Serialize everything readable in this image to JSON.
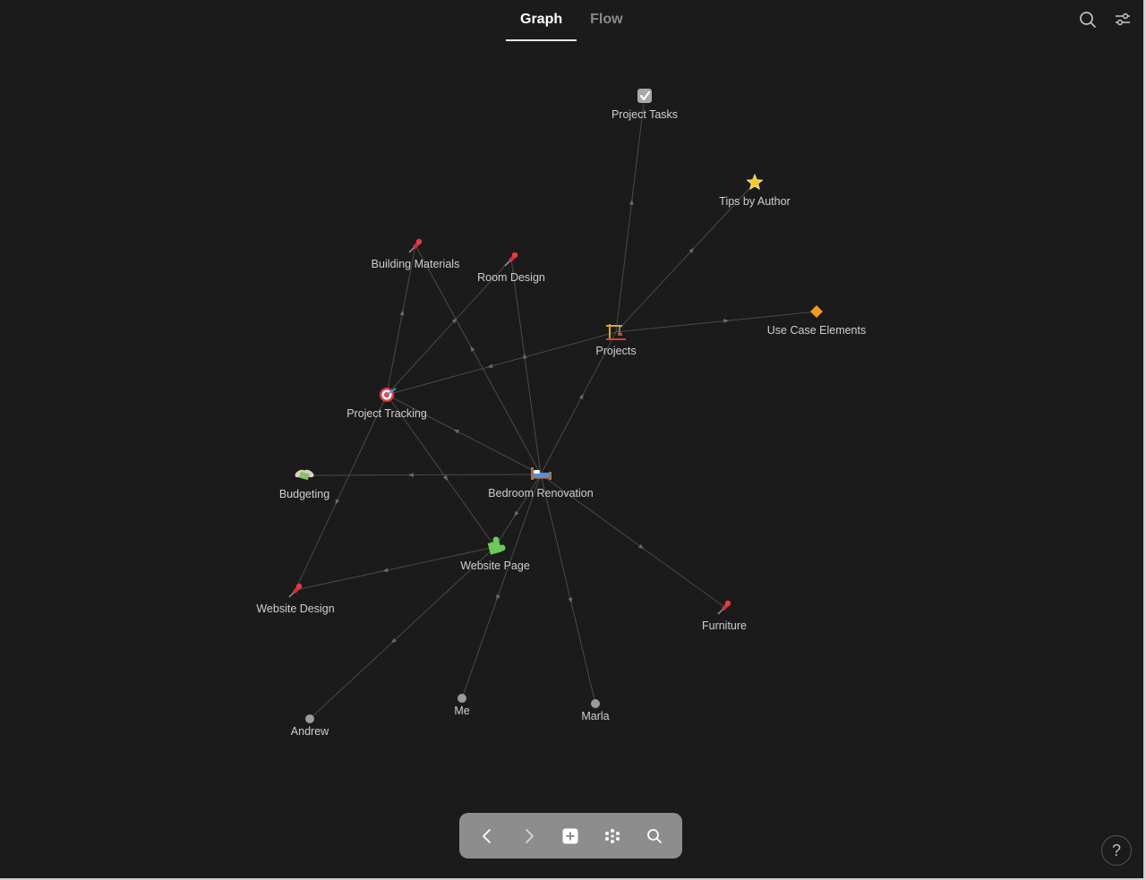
{
  "tabs": [
    {
      "label": "Graph",
      "active": true
    },
    {
      "label": "Flow",
      "active": false
    }
  ],
  "icons": {
    "search": "search-icon",
    "settings": "sliders-icon"
  },
  "graph": {
    "nodes": [
      {
        "id": "project-tasks",
        "label": "Project Tasks",
        "icon": "checkbox-icon"
      },
      {
        "id": "tips-by-author",
        "label": "Tips by Author",
        "icon": "star-icon"
      },
      {
        "id": "building-materials",
        "label": "Building Materials",
        "icon": "pushpin-icon"
      },
      {
        "id": "room-design",
        "label": "Room Design",
        "icon": "pushpin-icon"
      },
      {
        "id": "use-case-elements",
        "label": "Use Case Elements",
        "icon": "diamond-icon"
      },
      {
        "id": "projects",
        "label": "Projects",
        "icon": "crane-icon"
      },
      {
        "id": "project-tracking",
        "label": "Project Tracking",
        "icon": "target-icon"
      },
      {
        "id": "budgeting",
        "label": "Budgeting",
        "icon": "money-wings-icon"
      },
      {
        "id": "bedroom-renovation",
        "label": "Bedroom Renovation",
        "icon": "bed-icon"
      },
      {
        "id": "website-page",
        "label": "Website Page",
        "icon": "puzzle-icon"
      },
      {
        "id": "website-design",
        "label": "Website Design",
        "icon": "pushpin-icon"
      },
      {
        "id": "furniture",
        "label": "Furniture",
        "icon": "pushpin-icon"
      },
      {
        "id": "andrew",
        "label": "Andrew",
        "icon": "dot-icon"
      },
      {
        "id": "me",
        "label": "Me",
        "icon": "dot-icon"
      },
      {
        "id": "marla",
        "label": "Marla",
        "icon": "dot-icon"
      }
    ],
    "edges": [
      [
        "projects",
        "project-tasks"
      ],
      [
        "projects",
        "tips-by-author"
      ],
      [
        "projects",
        "use-case-elements"
      ],
      [
        "projects",
        "project-tracking"
      ],
      [
        "bedroom-renovation",
        "projects"
      ],
      [
        "bedroom-renovation",
        "building-materials"
      ],
      [
        "bedroom-renovation",
        "room-design"
      ],
      [
        "bedroom-renovation",
        "project-tracking"
      ],
      [
        "bedroom-renovation",
        "budgeting"
      ],
      [
        "bedroom-renovation",
        "website-page"
      ],
      [
        "bedroom-renovation",
        "furniture"
      ],
      [
        "bedroom-renovation",
        "me"
      ],
      [
        "bedroom-renovation",
        "marla"
      ],
      [
        "project-tracking",
        "building-materials"
      ],
      [
        "project-tracking",
        "room-design"
      ],
      [
        "project-tracking",
        "website-page"
      ],
      [
        "project-tracking",
        "website-design"
      ],
      [
        "website-page",
        "website-design"
      ],
      [
        "website-page",
        "andrew"
      ]
    ],
    "edge_color": "#4a4a4a"
  },
  "toolbar": {
    "buttons": [
      "back-icon",
      "forward-icon",
      "add-icon",
      "graph-dots-icon",
      "search-icon"
    ]
  },
  "help_label": "?",
  "colors": {
    "background": "#1b1b1b",
    "toolbar": "#8d8d8d",
    "label": "#cfcfcf"
  }
}
